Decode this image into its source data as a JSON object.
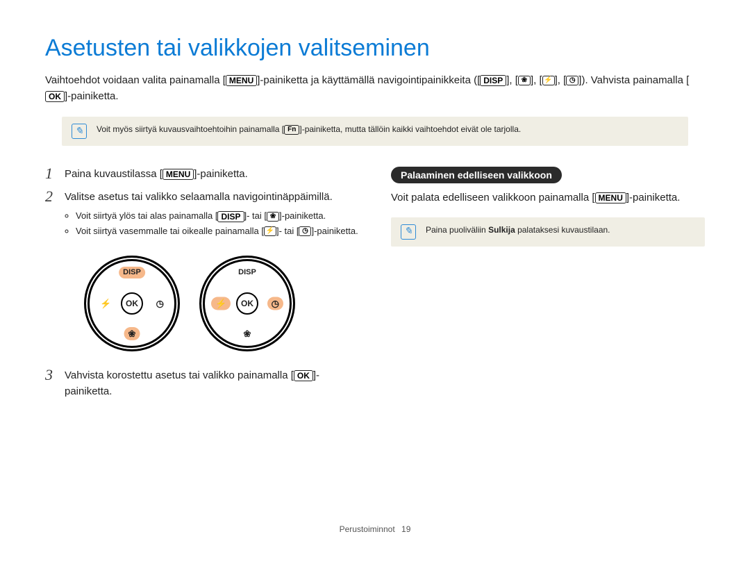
{
  "title": "Asetusten tai valikkojen valitseminen",
  "intro": {
    "p1_a": "Vaihtoehdot voidaan valita painamalla [",
    "menu": "MENU",
    "p1_b": "]-painiketta ja käyttämällä navigointipainikkeita ([",
    "disp": "DISP",
    "p1_c": "], [",
    "icon_down": "❀",
    "p1_d": "], [",
    "icon_flash": "⚡",
    "p1_e": "], [",
    "icon_timer": "◷",
    "p1_f": "]). Vahvista painamalla [",
    "ok": "OK",
    "p1_g": "]-painiketta."
  },
  "note1": {
    "a": "Voit myös siirtyä kuvausvaihtoehtoihin painamalla [",
    "fn": "Fn",
    "b": "]-painiketta, mutta tällöin kaikki vaihtoehdot eivät ole tarjolla."
  },
  "steps": {
    "s1_a": "Paina kuvaustilassa [",
    "s1_menu": "MENU",
    "s1_b": "]-painiketta.",
    "s2": "Valitse asetus tai valikko selaamalla navigointinäppäimillä.",
    "s2_b1_a": "Voit siirtyä ylös tai alas painamalla [",
    "s2_b1_disp": "DISP",
    "s2_b1_b": "]- tai [",
    "s2_b1_icon": "❀",
    "s2_b1_c": "]-painiketta.",
    "s2_b2_a": "Voit siirtyä vasemmalle tai oikealle painamalla [",
    "s2_b2_icon1": "⚡",
    "s2_b2_b": "]- tai [",
    "s2_b2_icon2": "◷",
    "s2_b2_c": "]-painiketta.",
    "s3_a": "Vahvista korostettu asetus tai valikko painamalla [",
    "s3_ok": "OK",
    "s3_b": "]-painiketta."
  },
  "dial": {
    "top": "DISP",
    "bottom": "❀",
    "left": "⚡",
    "right": "◷",
    "ok": "OK"
  },
  "right": {
    "pill": "Palaaminen edelliseen valikkoon",
    "body_a": "Voit palata edelliseen valikkoon painamalla [",
    "menu": "MENU",
    "body_b": "]-painiketta.",
    "note_a": "Paina puoliväliin ",
    "note_b": "Sulkija",
    "note_c": " palataksesi kuvaustilaan."
  },
  "footer": {
    "section": "Perustoiminnot",
    "page": "19"
  }
}
